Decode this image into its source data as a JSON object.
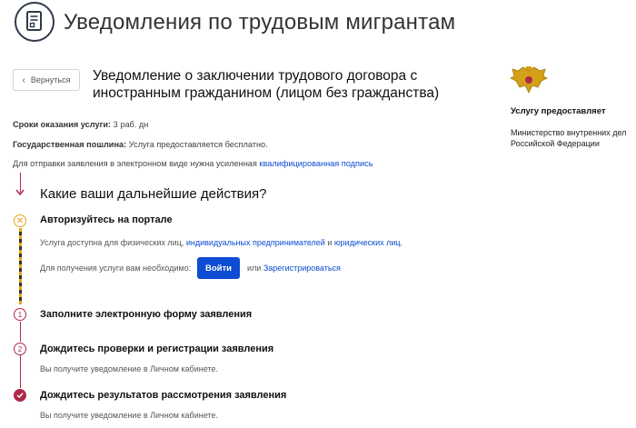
{
  "header": {
    "title": "Уведомления по трудовым мигрантам",
    "icon": "document-icon"
  },
  "back_button": {
    "label": "Вернуться"
  },
  "service": {
    "title": "Уведомление о заключении трудового договора с иностранным гражданином (лицом без гражданства)"
  },
  "provider": {
    "heading": "Услугу предоставляет",
    "name": "Министерство внутренних дел Российской Федерации"
  },
  "info": {
    "term_label": "Сроки оказания услуги:",
    "term_value": "3 раб. дн",
    "fee_label": "Государственная пошлина:",
    "fee_value": "Услуга предоставляется бесплатно.",
    "signature_text": "Для отправки заявления в электронном виде нужна усиленная",
    "signature_link": "квалифицированная подпись"
  },
  "steps_section": {
    "title": "Какие ваши дальнейшие действия?",
    "step1": {
      "title": "Авторизуйтесь на портале",
      "text_before": "Услуга доступна для физических лиц,",
      "link_ip": "индивидуальных предпринимателей",
      "text_and": "и",
      "link_ul": "юридических лиц",
      "text_end": ".",
      "need_text": "Для получения услуги вам необходимо:",
      "login_button": "Войти",
      "or_text": "или",
      "register_link": "Зарегистрироваться"
    },
    "step2": {
      "number": "1",
      "title": "Заполните электронную форму заявления"
    },
    "step3": {
      "number": "2",
      "title": "Дождитесь проверки и регистрации заявления",
      "text": "Вы получите уведомление в Личном кабинете."
    },
    "step4": {
      "title": "Дождитесь результатов рассмотрения заявления",
      "text": "Вы получите уведомление в Личном кабинете."
    }
  },
  "colors": {
    "accent": "#b0294a",
    "link": "#0d4cd3",
    "warning": "#e8a317"
  }
}
